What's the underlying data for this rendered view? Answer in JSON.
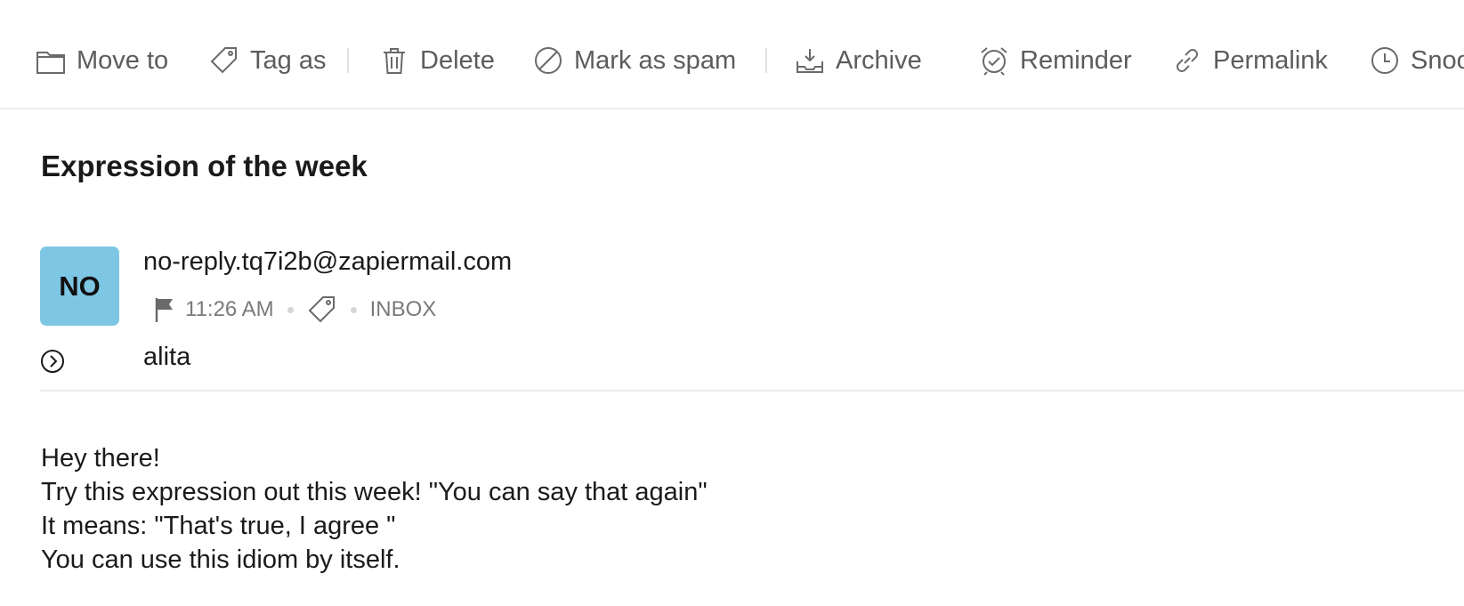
{
  "toolbar": {
    "move_to": "Move to",
    "tag_as": "Tag as",
    "delete": "Delete",
    "mark_as_spam": "Mark as spam",
    "archive": "Archive",
    "reminder": "Reminder",
    "permalink": "Permalink",
    "snooze": "Snooze"
  },
  "icons": {
    "move_to": "folder-icon",
    "tag_as": "tag-icon",
    "delete": "trash-icon",
    "mark_as_spam": "block-icon",
    "archive": "archive-icon",
    "reminder": "alarm-clock-icon",
    "permalink": "link-icon",
    "snooze": "clock-icon",
    "flag": "flag-icon",
    "meta_tag": "tag-icon",
    "expand": "chevron-right-circle-icon"
  },
  "email": {
    "subject": "Expression of the week",
    "avatar_initials": "NO",
    "sender": "no-reply.tq7i2b@zapiermail.com",
    "time": "11:26 AM",
    "folder": "INBOX",
    "recipient": "alita",
    "body_lines": [
      "Hey there!",
      "Try this expression out this week! \"You can say that again\"",
      "It means: \"That's true, I agree \"",
      "You can use this idiom by itself."
    ]
  },
  "colors": {
    "avatar_bg": "#7ec7e4",
    "toolbar_text": "#5c5c5c",
    "meta_text": "#7a7a7a"
  }
}
